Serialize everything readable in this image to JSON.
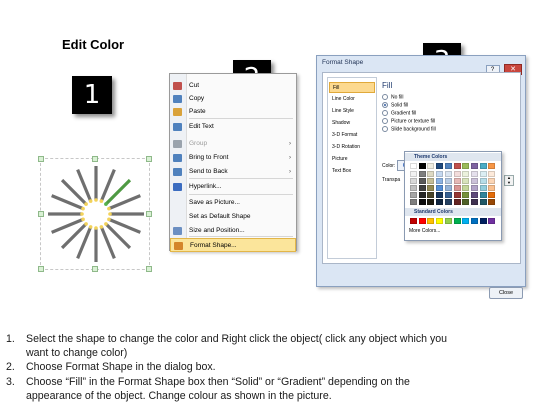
{
  "title": "Edit Color",
  "steps": {
    "one": "1",
    "two": "2",
    "three": "3"
  },
  "accent": {
    "highlight": "#fbe59b",
    "badge": "#000000",
    "pencil_body": "#6f6f6f",
    "pencil_tip": "#56b34c"
  },
  "shape": {
    "spoke_count": 16,
    "icon": "pencil-wheel-icon"
  },
  "context_menu": {
    "items": [
      {
        "label": "Cut",
        "icon": "scissors-icon",
        "state": "normal"
      },
      {
        "label": "Copy",
        "icon": "copy-icon",
        "state": "normal"
      },
      {
        "label": "Paste",
        "icon": "paste-icon",
        "state": "normal"
      },
      {
        "label": "Edit Text",
        "icon": "edit-text-icon",
        "state": "normal"
      },
      {
        "label": "Group",
        "icon": "group-icon",
        "state": "disabled",
        "submenu": "›"
      },
      {
        "label": "Bring to Front",
        "icon": "bring-front-icon",
        "state": "normal",
        "submenu": "›"
      },
      {
        "label": "Send to Back",
        "icon": "send-back-icon",
        "state": "normal",
        "submenu": "›"
      },
      {
        "label": "Hyperlink...",
        "icon": "hyperlink-icon",
        "state": "normal"
      },
      {
        "label": "Save as Picture...",
        "icon": "",
        "state": "normal"
      },
      {
        "label": "Set as Default Shape",
        "icon": "",
        "state": "normal"
      },
      {
        "label": "Size and Position...",
        "icon": "size-icon",
        "state": "normal"
      },
      {
        "label": "Format Shape...",
        "icon": "format-shape-icon",
        "state": "highlighted"
      }
    ]
  },
  "dialog": {
    "title": "Format Shape",
    "help_label": "?",
    "close_x": "✕",
    "nav": [
      "Fill",
      "Line Color",
      "Line Style",
      "Shadow",
      "3-D Format",
      "3-D Rotation",
      "Picture",
      "Text Box"
    ],
    "fill_heading": "Fill",
    "options": [
      {
        "label": "No fill",
        "selected": false
      },
      {
        "label": "Solid fill",
        "selected": true
      },
      {
        "label": "Gradient fill",
        "selected": false
      },
      {
        "label": "Picture or texture fill",
        "selected": false
      },
      {
        "label": "Slide background fill",
        "selected": false
      }
    ],
    "color_label": "Color:",
    "transparency_label": "Transpa",
    "close_button": "Close",
    "palette": {
      "theme_heading": "Theme Colors",
      "standard_heading": "Standard Colors",
      "more": "More Colors...",
      "theme_top": [
        "#ffffff",
        "#000000",
        "#eeece1",
        "#1f497d",
        "#4f81bd",
        "#c0504d",
        "#9bbb59",
        "#8064a2",
        "#4bacc6",
        "#f79646"
      ],
      "theme_shades": [
        [
          "#f2f2f2",
          "#7f7f7f",
          "#ddd9c3",
          "#c6d9f0",
          "#dbe5f1",
          "#f2dcdb",
          "#ebf1dd",
          "#e5e0ec",
          "#dbeef3",
          "#fdeada"
        ],
        [
          "#d8d8d8",
          "#595959",
          "#c4bd97",
          "#8db3e2",
          "#b8cce4",
          "#e5b9b7",
          "#d7e3bc",
          "#ccc1d9",
          "#b7dde8",
          "#fbd5b5"
        ],
        [
          "#bfbfbf",
          "#3f3f3f",
          "#938953",
          "#548dd4",
          "#95b3d7",
          "#d99694",
          "#c3d69b",
          "#b2a2c7",
          "#92cddc",
          "#fac08f"
        ],
        [
          "#a5a5a5",
          "#262626",
          "#494429",
          "#17365d",
          "#366092",
          "#953734",
          "#76923c",
          "#5f497a",
          "#31859b",
          "#e36c09"
        ],
        [
          "#7f7f7f",
          "#0c0c0c",
          "#1d1b10",
          "#0f243e",
          "#244061",
          "#632423",
          "#4f6128",
          "#3f3151",
          "#205867",
          "#974806"
        ]
      ],
      "standard": [
        "#c00000",
        "#ff0000",
        "#ffc000",
        "#ffff00",
        "#92d050",
        "#00b050",
        "#00b0f0",
        "#0070c0",
        "#002060",
        "#7030a0"
      ]
    }
  },
  "instructions": [
    {
      "num": "1.",
      "line1": "Select the shape to change the color and Right click the object( click any object which you",
      "line2": "want to change color)"
    },
    {
      "num": "2.",
      "line1": "Choose Format Shape in the dialog box.",
      "line2": ""
    },
    {
      "num": "3.",
      "line1": "Choose “Fill” in the Format Shape box then “Solid” or “Gradient” depending on the",
      "line2": "appearance of the object. Change colour as shown in the picture."
    }
  ]
}
